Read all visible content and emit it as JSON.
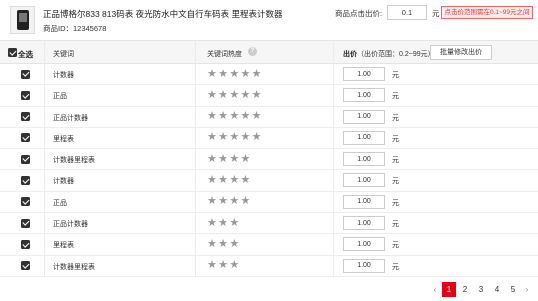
{
  "product": {
    "title": "正品博格尔833 813码表 夜光防水中文自行车码表 里程表计数器",
    "id_text": "商品ID：12345678"
  },
  "bid": {
    "label": "商品点击出价:",
    "value": "0.1",
    "unit": "元",
    "hint": "点击价范围需在0.1~99元之间"
  },
  "table": {
    "select_all": "全选",
    "col_keyword": "关键词",
    "col_heat": "关键词热度",
    "col_bid": "出价",
    "col_bid_range": "（出价范围：0.2~99元）",
    "batch_button": "批量修改出价",
    "unit": "元",
    "rows": [
      {
        "keyword": "计数器",
        "stars": "★★★★★",
        "bid": "1.00"
      },
      {
        "keyword": "正品",
        "stars": "★★★★★",
        "bid": "1.00"
      },
      {
        "keyword": "正品计数器",
        "stars": "★★★★★",
        "bid": "1.00"
      },
      {
        "keyword": "里程表",
        "stars": "★★★★★",
        "bid": "1.00"
      },
      {
        "keyword": "计数器里程表",
        "stars": "★★★★",
        "bid": "1.00"
      },
      {
        "keyword": "计数器",
        "stars": "★★★★",
        "bid": "1.00"
      },
      {
        "keyword": "正品",
        "stars": "★★★★",
        "bid": "1.00"
      },
      {
        "keyword": "正品计数器",
        "stars": "★★★",
        "bid": "1.00"
      },
      {
        "keyword": "里程表",
        "stars": "★★★",
        "bid": "1.00"
      },
      {
        "keyword": "计数器里程表",
        "stars": "★★★",
        "bid": "1.00"
      }
    ]
  },
  "pagination": {
    "prev": "‹",
    "next": "›",
    "pages": [
      "1",
      "2",
      "3",
      "4",
      "5"
    ],
    "current": "1"
  },
  "colors": {
    "accent": "#e40012",
    "star": "#999999",
    "hint_border": "#e46a6a"
  }
}
